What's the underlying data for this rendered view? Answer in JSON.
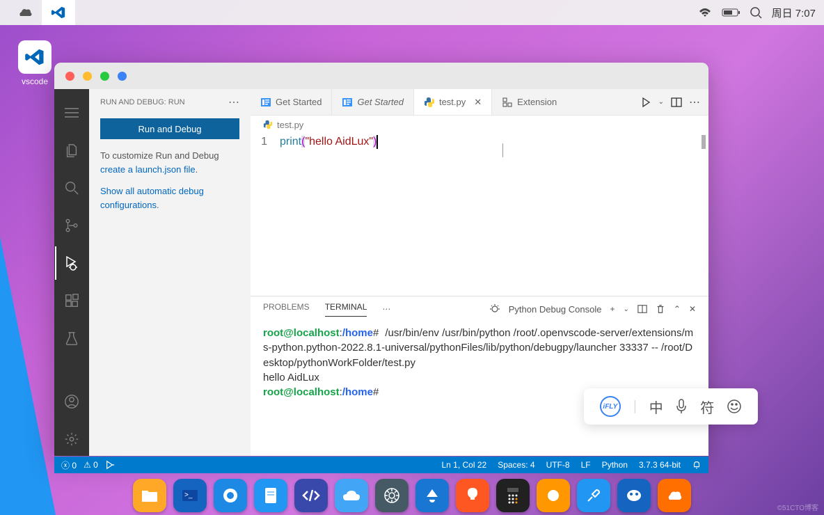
{
  "menubar": {
    "time": "周日 7:07"
  },
  "desktop": {
    "vscode_label": "vscode"
  },
  "sidebar": {
    "title": "RUN AND DEBUG: RUN",
    "run_button": "Run and Debug",
    "customize_pre": "To customize Run and Debug ",
    "customize_link": "create a launch.json file",
    "customize_post": ".",
    "show_all_pre": "Show all automatic debug configurations",
    "show_all_post": "."
  },
  "tabs": {
    "t1": "Get Started",
    "t2": "Get Started",
    "t3": "test.py",
    "t4": "Extension"
  },
  "breadcrumb": {
    "file": "test.py"
  },
  "editor": {
    "line_no": "1",
    "fn": "print",
    "lp": "(",
    "str": "\"hello AidLux\"",
    "rp": ")"
  },
  "panel": {
    "problems": "PROBLEMS",
    "terminal": "TERMINAL",
    "console_name": "Python Debug Console"
  },
  "terminal": {
    "prompt_user": "root@localhost",
    "prompt_sep": ":",
    "prompt_path": "/home",
    "prompt_end": "#",
    "cmd": " /usr/bin/env /usr/bin/python /root/.openvscode-server/extensions/ms-python.python-2022.8.1-universal/pythonFiles/lib/python/debugpy/launcher 33337 -- /root/Desktop/pythonWorkFolder/test.py",
    "output": "hello AidLux"
  },
  "status": {
    "errors": "0",
    "warnings": "0",
    "ln_col": "Ln 1, Col 22",
    "spaces": "Spaces: 4",
    "encoding": "UTF-8",
    "eol": "LF",
    "lang": "Python",
    "py": "3.7.3 64-bit"
  },
  "ime": {
    "zhong": "中",
    "fu": "符"
  },
  "watermark": "©51CTO博客"
}
